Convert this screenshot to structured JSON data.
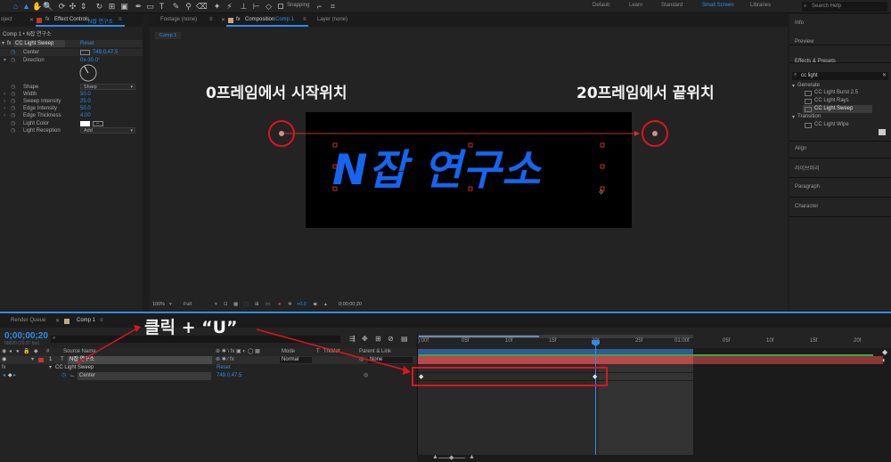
{
  "toolbar": {
    "snapping_label": "Snapping",
    "workspaces": [
      "Default",
      "Learn",
      "Standard",
      "Small Screen",
      "Libraries"
    ],
    "active_workspace": "Small Screen",
    "search_placeholder": "Search Help"
  },
  "left_panel": {
    "tab_project": "oject",
    "tab_effect_controls": "Effect Controls",
    "tab_effect_layer": "N잡 연구소",
    "breadcrumb": "Comp 1 • N잡 연구소",
    "effect_name": "CC Light Sweep",
    "reset_label": "Reset",
    "properties": [
      {
        "label": "Center",
        "value": "749.0,47.5"
      },
      {
        "label": "Direction",
        "value": "0x-30.0°"
      },
      {
        "label": "Shape",
        "value": "Sharp"
      },
      {
        "label": "Width",
        "value": "50.0"
      },
      {
        "label": "Sweep Intensity",
        "value": "25.0"
      },
      {
        "label": "Edge Intensity",
        "value": "50.0"
      },
      {
        "label": "Edge Thickness",
        "value": "4.00"
      },
      {
        "label": "Light Color",
        "value": ""
      },
      {
        "label": "Light Reception",
        "value": "Add"
      }
    ]
  },
  "viewer": {
    "tab_footage": "Footage (none)",
    "tab_composition": "Composition",
    "tab_composition_name": "Comp 1",
    "tab_layer": "Layer (none)",
    "comp_chip": "Comp 1",
    "comp_text": "N잡 연구소",
    "annotation_start": "0프레임에서 시작위치",
    "annotation_end": "20프레임에서 끝위치",
    "zoom": "100%",
    "resolution": "Full",
    "exposure": "+0.0",
    "timecode": "0;00;00;20"
  },
  "right_panel": {
    "info": "Info",
    "preview": "Preview",
    "effects_presets": "Effects & Presets",
    "search_value": "cc light",
    "generate": "Generate",
    "generate_items": [
      "CC Light Burst 2.5",
      "CC Light Rays",
      "CC Light Sweep"
    ],
    "transition": "Transition",
    "transition_items": [
      "CC Light Wipe"
    ],
    "align": "Align",
    "library": "라이브러리",
    "paragraph": "Paragraph",
    "character": "Character"
  },
  "timeline": {
    "tab_render_queue": "Render Queue",
    "tab_comp": "Comp 1",
    "timecode": "0;00;00;20",
    "timecode_sub": "00020 (29.97 fps)",
    "col_source_name": "Source Name",
    "col_mode": "Mode",
    "col_t": "T",
    "col_trkmat": "TrkMat",
    "col_parent": "Parent & Link",
    "layer_number": "1",
    "layer_name": "N잡 연구소",
    "layer_mode": "Normal",
    "layer_parent": "None",
    "effect_name": "CC Light Sweep",
    "effect_reset": "Reset",
    "property_name": "Center",
    "property_value": "749.0,47.5",
    "ruler_labels": [
      "):00f",
      "05f",
      "10f",
      "15f",
      "20f",
      "25f",
      "01:00f",
      "05f",
      "10f",
      "15f",
      "20f"
    ],
    "annotation": "클릭 + “U”"
  },
  "colors": {
    "accent": "#2d8ceb",
    "annotation_red": "#e0141e",
    "layer_bar": "#b84a4a",
    "comp_text_blue": "#1565f0"
  }
}
